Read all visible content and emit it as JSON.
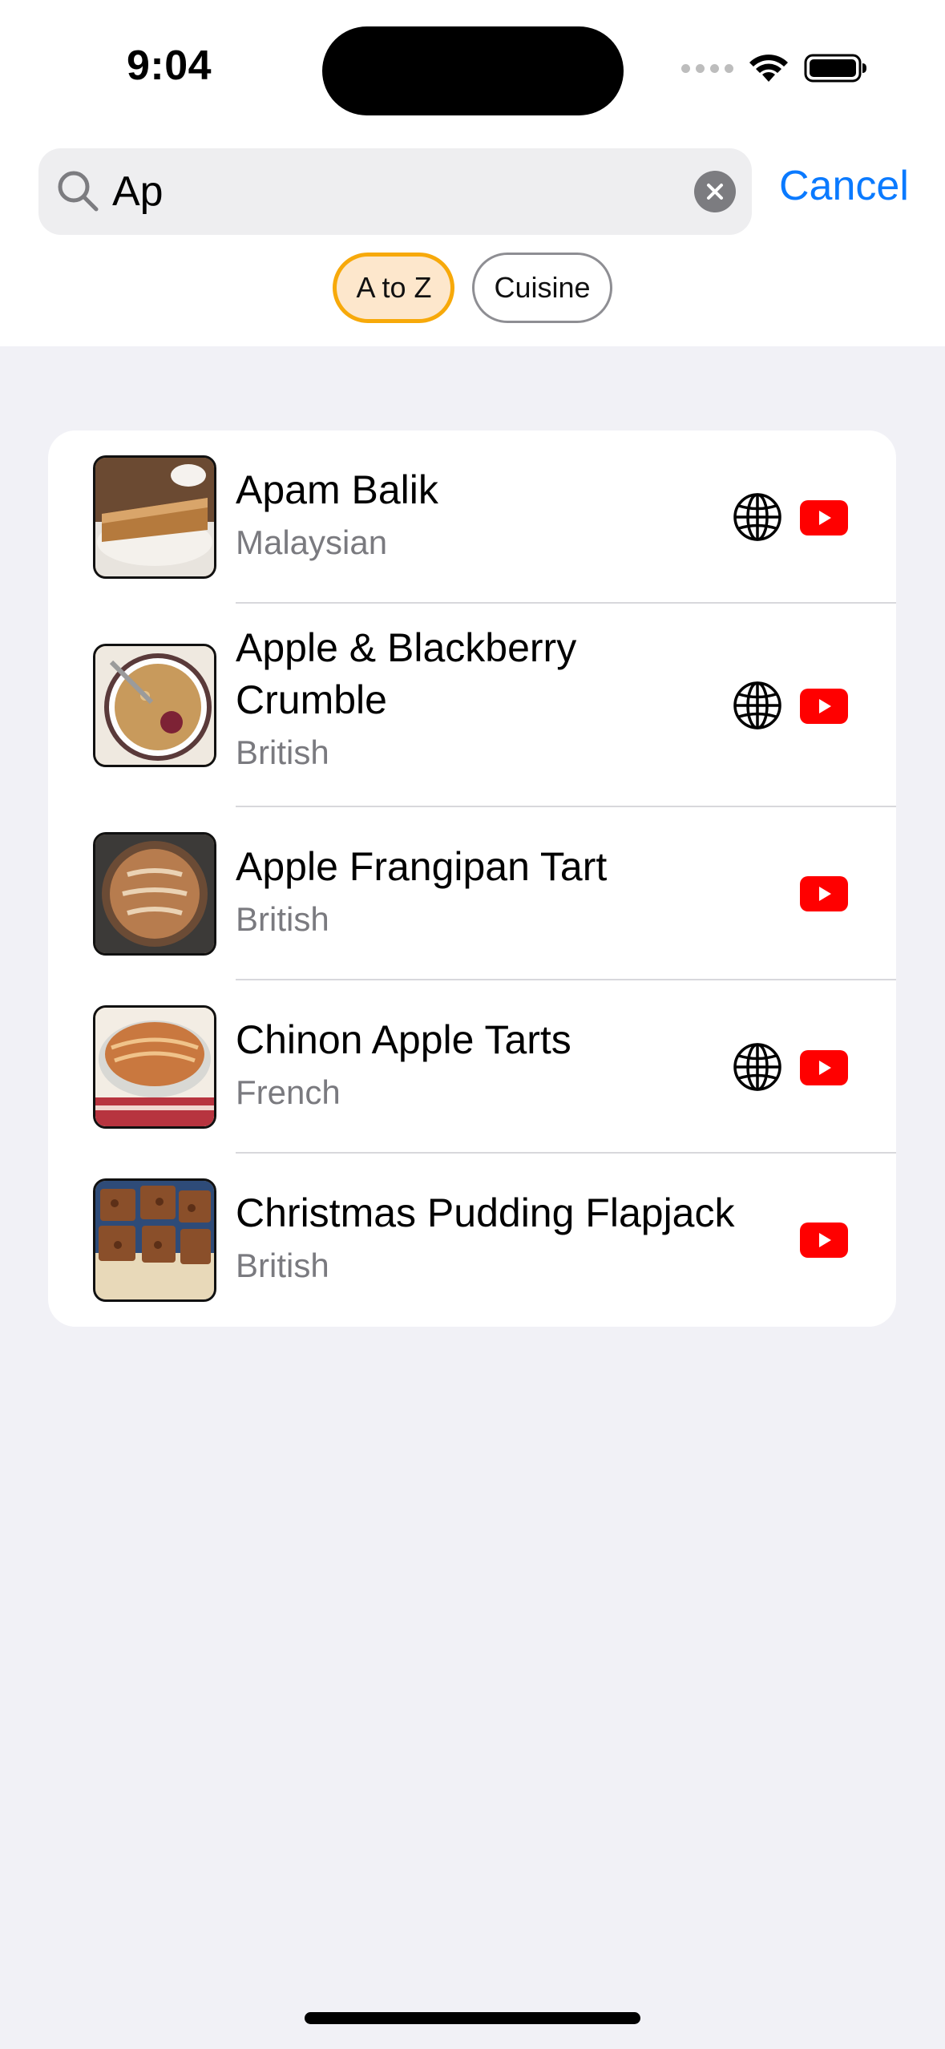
{
  "status_bar": {
    "time": "9:04"
  },
  "search": {
    "query": "Ap",
    "placeholder": "",
    "cancel_label": "Cancel"
  },
  "filters": [
    {
      "label": "A to Z",
      "selected": true
    },
    {
      "label": "Cuisine",
      "selected": false
    }
  ],
  "results": [
    {
      "title": "Apam Balik",
      "cuisine": "Malaysian",
      "has_website": true,
      "has_youtube": true
    },
    {
      "title": "Apple & Blackberry Crumble",
      "cuisine": "British",
      "has_website": true,
      "has_youtube": true
    },
    {
      "title": "Apple Frangipan Tart",
      "cuisine": "British",
      "has_website": false,
      "has_youtube": true
    },
    {
      "title": "Chinon Apple Tarts",
      "cuisine": "French",
      "has_website": true,
      "has_youtube": true
    },
    {
      "title": "Christmas Pudding Flapjack",
      "cuisine": "British",
      "has_website": false,
      "has_youtube": true
    }
  ],
  "colors": {
    "accent": "#0a7aff",
    "chip_selected_border": "#f7a90a",
    "chip_selected_fill": "#fde7cc",
    "youtube_red": "#ff0000",
    "background": "#f1f1f6"
  },
  "icons": [
    "search-icon",
    "clear-icon",
    "globe-icon",
    "youtube-icon",
    "wifi-icon",
    "battery-icon"
  ]
}
